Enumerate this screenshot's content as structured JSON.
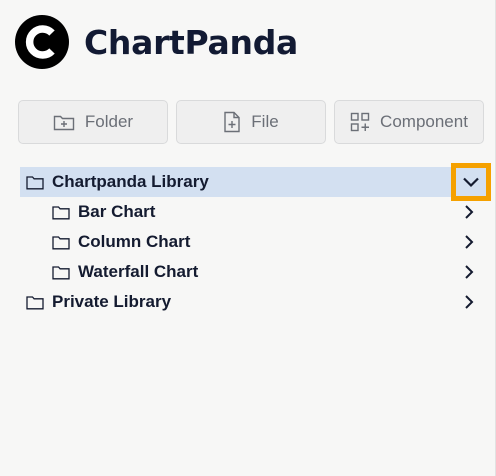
{
  "app": {
    "title": "ChartPanda"
  },
  "actions": {
    "folder_label": "Folder",
    "file_label": "File",
    "component_label": "Component"
  },
  "tree": {
    "items": [
      {
        "label": "Chartpanda Library",
        "level": 0,
        "expanded": true,
        "selected": true
      },
      {
        "label": "Bar Chart",
        "level": 1,
        "expanded": false
      },
      {
        "label": "Column Chart",
        "level": 1,
        "expanded": false
      },
      {
        "label": "Waterfall Chart",
        "level": 1,
        "expanded": false
      },
      {
        "label": "Private Library",
        "level": 0,
        "expanded": false
      }
    ]
  },
  "colors": {
    "selected_bg": "#d3e0f1",
    "highlight": "#f5a100",
    "text": "#141b30"
  }
}
